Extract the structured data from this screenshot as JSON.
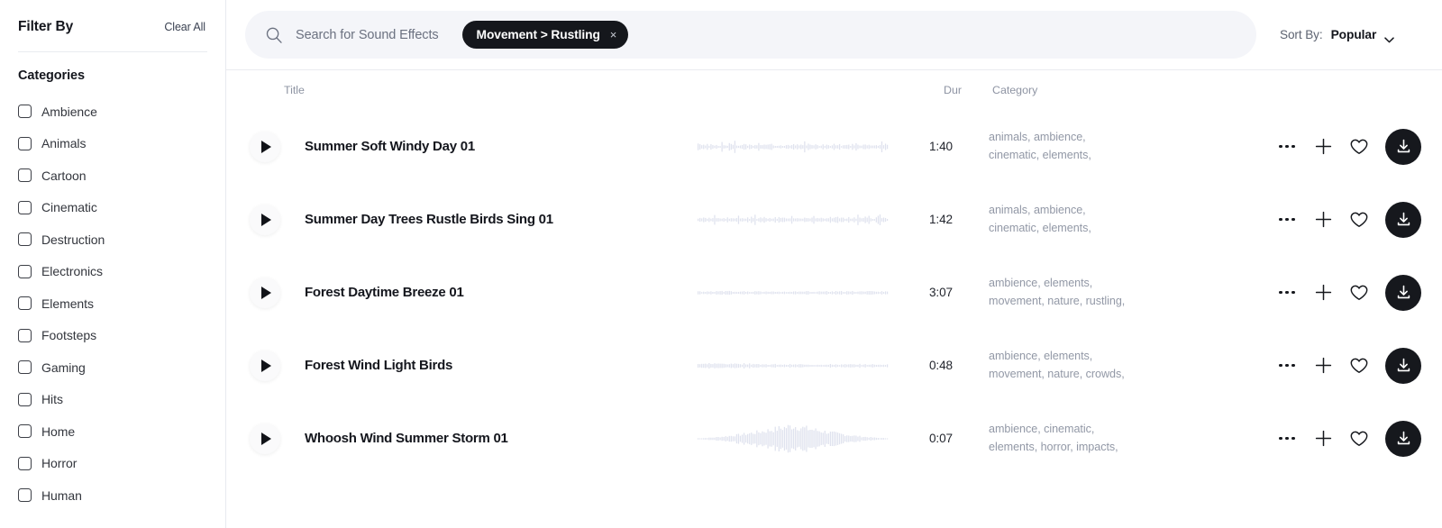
{
  "sidebar": {
    "filter_by": "Filter By",
    "clear_all": "Clear All",
    "categories_heading": "Categories",
    "categories": [
      {
        "label": "Ambience"
      },
      {
        "label": "Animals"
      },
      {
        "label": "Cartoon"
      },
      {
        "label": "Cinematic"
      },
      {
        "label": "Destruction"
      },
      {
        "label": "Electronics"
      },
      {
        "label": "Elements"
      },
      {
        "label": "Footsteps"
      },
      {
        "label": "Gaming"
      },
      {
        "label": "Hits"
      },
      {
        "label": "Home"
      },
      {
        "label": "Horror"
      },
      {
        "label": "Human"
      }
    ]
  },
  "search": {
    "placeholder": "Search for Sound Effects",
    "chip_label": "Movement > Rustling",
    "chip_close": "×"
  },
  "sort": {
    "label": "Sort By:",
    "value": "Popular"
  },
  "table": {
    "headers": {
      "title": "Title",
      "duration": "Dur",
      "category": "Category"
    },
    "rows": [
      {
        "title": "Summer Soft Windy Day 01",
        "duration": "1:40",
        "categories_line1": "animals, ambience,",
        "categories_line2": "cinematic, elements,",
        "waveform": "flat-dense"
      },
      {
        "title": "Summer Day Trees Rustle Birds Sing 01",
        "duration": "1:42",
        "categories_line1": "animals, ambience,",
        "categories_line2": "cinematic, elements,",
        "waveform": "flat-dense"
      },
      {
        "title": "Forest Daytime Breeze 01",
        "duration": "3:07",
        "categories_line1": "ambience, elements,",
        "categories_line2": "movement, nature, rustling,",
        "waveform": "flat-sparse"
      },
      {
        "title": "Forest Wind Light Birds",
        "duration": "0:48",
        "categories_line1": "ambience, elements,",
        "categories_line2": "movement, nature, crowds,",
        "waveform": "flat-left"
      },
      {
        "title": "Whoosh Wind Summer Storm 01",
        "duration": "0:07",
        "categories_line1": "ambience, cinematic,",
        "categories_line2": "elements, horror, impacts,",
        "waveform": "spindle"
      }
    ],
    "row_actions": {
      "more": "more-options",
      "add": "add-to-playlist",
      "favorite": "favorite",
      "download": "download"
    }
  },
  "colors": {
    "accent_dark": "#16181d",
    "search_bg": "#f4f5f9",
    "waveform": "#dfe2ee",
    "muted_text": "#9298a6"
  }
}
